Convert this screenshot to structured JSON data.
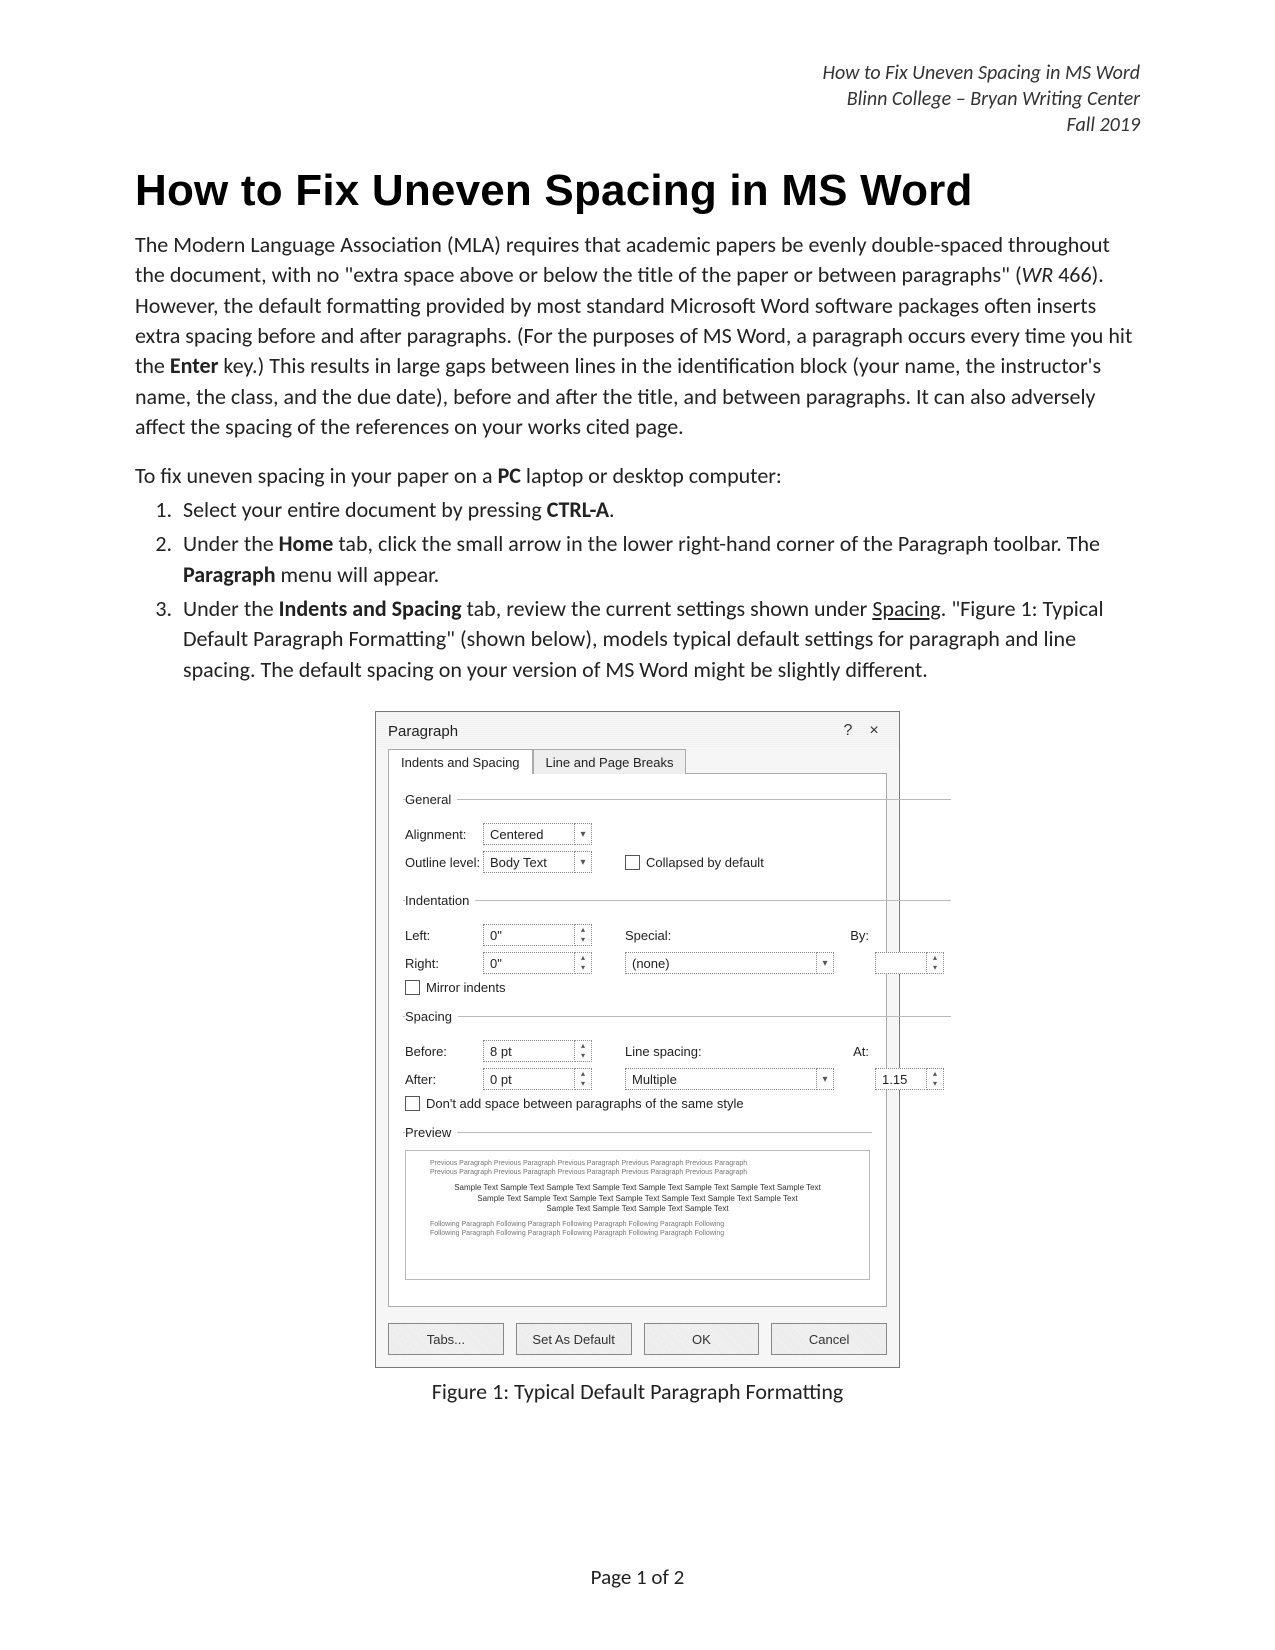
{
  "header": {
    "line1": "How to Fix Uneven Spacing in MS Word",
    "line2": "Blinn College – Bryan Writing Center",
    "line3": "Fall 2019"
  },
  "title": "How to Fix Uneven Spacing in MS Word",
  "intro": {
    "p1_a": "The Modern Language Association (MLA) requires that academic papers be evenly double-spaced throughout the document, with no \"extra space above or below the title of the paper or between paragraphs\" (",
    "p1_cite": "WR",
    "p1_b": " 466). However, the default formatting provided by most standard Microsoft Word software packages often inserts extra spacing before and after paragraphs. (For the purposes of MS Word, a paragraph occurs every time you hit the ",
    "p1_enter": "Enter",
    "p1_c": " key.) This results in large gaps between lines in the identification block (your name, the instructor's name, the class, and the due date), before and after the title, and between paragraphs. It can also adversely affect the spacing of the references on your works cited page.",
    "p2_a": "To fix uneven spacing in your paper on a ",
    "p2_pc": "PC",
    "p2_b": " laptop or desktop computer:"
  },
  "steps": {
    "s1_a": "Select your entire document by pressing ",
    "s1_key": "CTRL-A",
    "s1_b": ".",
    "s2_a": "Under the ",
    "s2_home": "Home",
    "s2_b": " tab, click the small arrow in the lower right-hand corner of the Paragraph toolbar. The ",
    "s2_para": "Paragraph",
    "s2_c": " menu will appear.",
    "s3_a": "Under the ",
    "s3_tab": "Indents and Spacing",
    "s3_b": " tab, review the current settings shown under ",
    "s3_spacing": "Spacing",
    "s3_c": ". \"Figure 1: Typical Default Paragraph Formatting\" (shown below), models typical default settings for paragraph and line spacing. The default spacing on your version of MS Word might be slightly different."
  },
  "dialog": {
    "title": "Paragraph",
    "help": "?",
    "close": "×",
    "tab_active": "Indents and Spacing",
    "tab_inactive": "Line and Page Breaks",
    "section_general": "General",
    "alignment_label": "Alignment:",
    "alignment_value": "Centered",
    "outline_label": "Outline level:",
    "outline_value": "Body Text",
    "collapsed_label": "Collapsed by default",
    "section_indent": "Indentation",
    "left_label": "Left:",
    "left_value": "0\"",
    "right_label": "Right:",
    "right_value": "0\"",
    "special_label": "Special:",
    "special_value": "(none)",
    "by_label": "By:",
    "by_value": "",
    "mirror_label": "Mirror indents",
    "section_spacing": "Spacing",
    "before_label": "Before:",
    "before_value": "8 pt",
    "after_label": "After:",
    "after_value": "0 pt",
    "linesp_label": "Line spacing:",
    "linesp_value": "Multiple",
    "at_label": "At:",
    "at_value": "1.15",
    "noadd_label": "Don't add space between paragraphs of the same style",
    "section_preview": "Preview",
    "btn_tabs": "Tabs...",
    "btn_default": "Set As Default",
    "btn_ok": "OK",
    "btn_cancel": "Cancel"
  },
  "caption": "Figure 1: Typical Default Paragraph Formatting",
  "footer": "Page 1 of 2"
}
